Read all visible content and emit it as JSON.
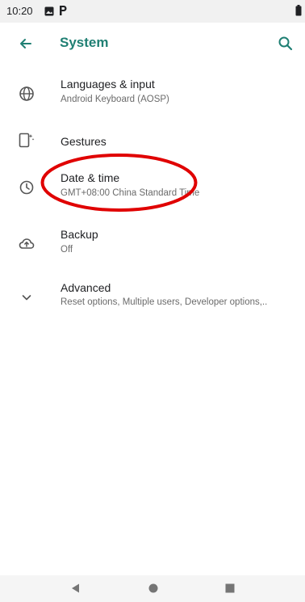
{
  "status_bar": {
    "time": "10:20",
    "icons": [
      "photo-icon",
      "parking-icon",
      "battery-icon"
    ]
  },
  "app_bar": {
    "title": "System",
    "back_icon": "back-arrow-icon",
    "search_icon": "search-icon"
  },
  "settings": {
    "items": [
      {
        "icon": "globe-icon",
        "title": "Languages & input",
        "summary": "Android Keyboard (AOSP)"
      },
      {
        "icon": "gestures-icon",
        "title": "Gestures",
        "summary": ""
      },
      {
        "icon": "clock-icon",
        "title": "Date & time",
        "summary": "GMT+08:00 China Standard Time"
      },
      {
        "icon": "cloud-upload-icon",
        "title": "Backup",
        "summary": "Off"
      },
      {
        "icon": "chevron-down-icon",
        "title": "Advanced",
        "summary": "Reset options, Multiple users, Developer options,.."
      }
    ]
  },
  "navigation": {
    "buttons": [
      "back",
      "home",
      "recents"
    ]
  },
  "colors": {
    "accent": "#1f7f73",
    "annotation": "#e00000",
    "text_primary": "#202124",
    "text_secondary": "#6b6b6b"
  }
}
